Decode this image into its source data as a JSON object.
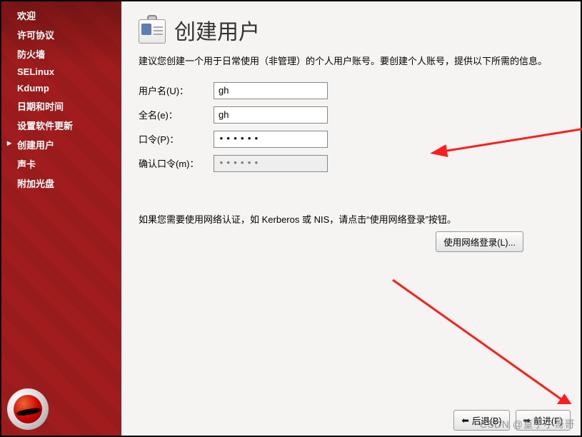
{
  "sidebar": {
    "items": [
      {
        "label": "欢迎"
      },
      {
        "label": "许可协议"
      },
      {
        "label": "防火墙"
      },
      {
        "label": "SELinux"
      },
      {
        "label": "Kdump"
      },
      {
        "label": "日期和时间"
      },
      {
        "label": "设置软件更新"
      },
      {
        "label": "创建用户",
        "current": true
      },
      {
        "label": "声卡"
      },
      {
        "label": "附加光盘"
      }
    ]
  },
  "header": {
    "title": "创建用户",
    "icon": "id-badge-icon"
  },
  "intro": "建议您创建一个用于日常使用（非管理）的个人用户账号。要创建个人账号，提供以下所需的信息。",
  "form": {
    "username_label": "用户名(U)：",
    "username_value": "gh",
    "fullname_label": "全名(e)：",
    "fullname_value": "gh",
    "password_label": "口令(P)：",
    "password_value": "••••••",
    "confirm_label": "确认口令(m)：",
    "confirm_value": "••••••"
  },
  "network_note": "如果您需要使用网络认证，如 Kerberos 或 NIS，请点击“使用网络登录”按钮。",
  "buttons": {
    "network_login": "使用网络登录(L)...",
    "back": "后退(B)",
    "forward": "前进(F)"
  },
  "watermark": "CSDN @篁子小哥哥",
  "colors": {
    "sidebar": "#a11c1c"
  }
}
